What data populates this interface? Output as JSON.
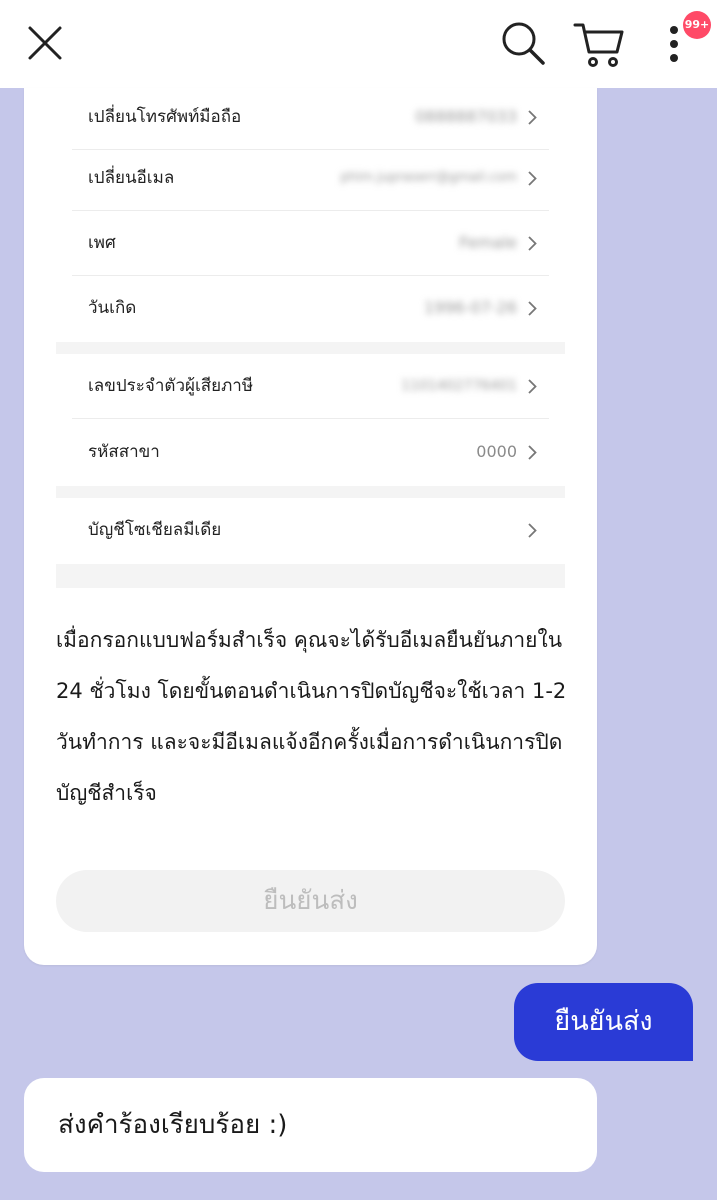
{
  "header": {
    "close_icon": "close-icon",
    "search_icon": "search-icon",
    "cart_icon": "cart-icon",
    "more_icon": "more-vertical-icon",
    "badge": "99+"
  },
  "rows": [
    {
      "label": "เปลี่ยนโทรศัพท์มือถือ",
      "value": "0888887033"
    },
    {
      "label": "เปลี่ยนอีเมล",
      "value": "phim.jupraserr@gmail.com"
    },
    {
      "label": "เพศ",
      "value": "Female"
    },
    {
      "label": "วันเกิด",
      "value": "1996-07-26"
    },
    {
      "label": "เลขประจำตัวผู้เสียภาษี",
      "value": "1101402776401"
    },
    {
      "label": "รหัสสาขา",
      "value": "0000"
    },
    {
      "label": "บัญชีโซเชียลมีเดีย",
      "value": ""
    }
  ],
  "info_text": "เมื่อกรอกแบบฟอร์มสำเร็จ คุณจะได้รับอีเมลยืนยันภายใน 24 ชั่วโมง โดยขั้นตอนดำเนินการปิดบัญชีจะใช้เวลา 1-2 วันทำการ และจะมีอีเมลแจ้งอีกครั้งเมื่อการดำเนินการปิดบัญชีสำเร็จ",
  "confirm_button_label": "ยืนยันส่ง",
  "chat": {
    "outgoing": "ยืนยันส่ง",
    "incoming": "ส่งคำร้องเรียบร้อย :)"
  },
  "colors": {
    "background": "#c5c7ea",
    "outgoing_bubble": "#2a3bd6",
    "badge": "#ff4a67"
  }
}
